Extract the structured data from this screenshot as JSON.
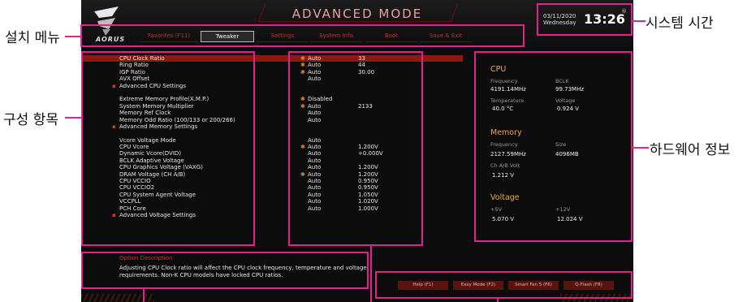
{
  "callouts": {
    "setup_menu": "설치 메뉴",
    "config_items": "구성 항목",
    "system_time": "시스템 시간",
    "hardware_info": "하드웨어 정보"
  },
  "header": {
    "mode_title": "ADVANCED MODE",
    "brand": "AORUS",
    "tabs": [
      "Favorites (F11)",
      "Tweaker",
      "Settings",
      "System Info.",
      "Boot",
      "Save & Exit"
    ],
    "active_tab": "Tweaker",
    "date_line1": "03/11/2020",
    "date_line2": "Wednesday",
    "time": "13:26",
    "time_symbol": "®"
  },
  "settings": [
    {
      "label": "CPU Clock Ratio",
      "star": "✱",
      "value1": "Auto",
      "value2": "33",
      "selected": true
    },
    {
      "label": "Ring Ratio",
      "star": "✱",
      "value1": "Auto",
      "value2": "44"
    },
    {
      "label": "IGP Ratio",
      "star": "✱",
      "value1": "Auto",
      "value2": "30.00"
    },
    {
      "label": "AVX Offset",
      "value1": "Auto"
    },
    {
      "label": "Advanced CPU Settings",
      "submenu": true
    },
    {
      "gap": true
    },
    {
      "label": "Extreme Memory Profile(X.M.P.)",
      "star": "✱",
      "value1": "Disabled"
    },
    {
      "label": "System Memory Multiplier",
      "star": "✱",
      "value1": "Auto",
      "value2": "2133"
    },
    {
      "label": "Memory Ref Clock",
      "value1": "Auto"
    },
    {
      "label": "Memory Odd Ratio (100/133 or 200/266)",
      "value1": "Auto"
    },
    {
      "label": "Advanced Memory Settings",
      "submenu": true
    },
    {
      "gap": true
    },
    {
      "label": "Vcore Voltage Mode",
      "value1": "Auto"
    },
    {
      "label": "CPU Vcore",
      "star": "✱",
      "value1": "Auto",
      "value2": "1.200V"
    },
    {
      "label": "Dynamic Vcore(DVID)",
      "value1": "Auto",
      "value2": "+0.000V"
    },
    {
      "label": "BCLK Adaptive Voltage",
      "value1": "Auto"
    },
    {
      "label": "CPU Graphics Voltage (VAXG)",
      "value1": "Auto",
      "value2": "1.200V"
    },
    {
      "label": "DRAM Voltage    (CH A/B)",
      "star": "✱",
      "value1": "Auto",
      "value2": "1.200V"
    },
    {
      "label": "CPU VCCIO",
      "value1": "Auto",
      "value2": "0.950V"
    },
    {
      "label": "CPU VCCIO2",
      "value1": "Auto",
      "value2": "0.950V"
    },
    {
      "label": "CPU System Agent Voltage",
      "value1": "Auto",
      "value2": "1.050V"
    },
    {
      "label": "VCCPLL",
      "value1": "Auto",
      "value2": "1.020V"
    },
    {
      "label": "PCH Core",
      "value1": "Auto",
      "value2": "1.000V"
    },
    {
      "label": "Advanced Voltage Settings",
      "submenu": true
    }
  ],
  "submenu_marker": "▪",
  "hardware": {
    "cpu": {
      "title": "CPU",
      "freq_label": "Frequency",
      "freq": "4191.14MHz",
      "bclk_label": "BCLK",
      "bclk": "99.73MHz",
      "temp_label": "Temperature",
      "temp": "40.0 °C",
      "volt_label": "Voltage",
      "volt": "0.924 V"
    },
    "memory": {
      "title": "Memory",
      "freq_label": "Frequency",
      "freq": "2127.59MHz",
      "size_label": "Size",
      "size": "4096MB",
      "chvolt_label": "Ch A/B Volt",
      "chvolt": "1.212 V"
    },
    "voltage": {
      "title": "Voltage",
      "p5_label": "+5V",
      "p5": "5.070 V",
      "p12_label": "+12V",
      "p12": "12.024 V"
    }
  },
  "description": {
    "title": "Option Description",
    "text": "Adjusting CPU Clock ratio will affect the CPU clock frequency, temperature and voltage requirements. Non-K CPU models have locked CPU ratios."
  },
  "buttons": [
    "Help (F1)",
    "Easy Mode (F2)",
    "Smart Fan 5 (F6)",
    "Q-Flash (F8)"
  ],
  "highlight_color": "#e3218f",
  "accent_color": "#d8302a"
}
